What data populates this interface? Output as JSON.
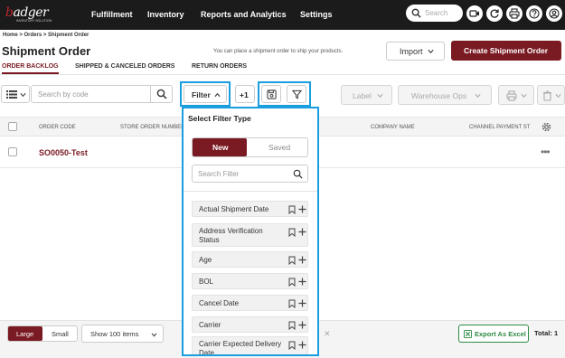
{
  "app": {
    "logo": "badger",
    "logo_sub": "INVENTORY SOLUTION"
  },
  "nav": {
    "items": [
      "Fulfillment",
      "Inventory",
      "Reports and Analytics",
      "Settings"
    ],
    "search_placeholder": "Search"
  },
  "header": {
    "breadcrumb": "Home  >  Orders  >  Shipment Order",
    "title": "Shipment Order",
    "hint": "You can place a shipment order to ship your products.",
    "import_label": "Import",
    "create_label": "Create Shipment Order"
  },
  "tabs": [
    "ORDER BACKLOG",
    "SHIPPED & CANCELED ORDERS",
    "RETURN ORDERS"
  ],
  "toolbar": {
    "code_search_placeholder": "Search by code",
    "filter_label": "Filter",
    "plus_one": "+1",
    "label_btn": "Label",
    "warehouse_ops_btn": "Warehouse Ops"
  },
  "table": {
    "columns": [
      "ORDER CODE",
      "STORE ORDER NUMBER",
      "COMPANY NAME",
      "CHANNEL PAYMENT ST"
    ],
    "rows": [
      {
        "order_code": "SO0050-Test"
      }
    ]
  },
  "filter_panel": {
    "title": "Select Filter Type",
    "tab_new": "New",
    "tab_saved": "Saved",
    "search_placeholder": "Search Filter",
    "items": [
      "Actual Shipment Date",
      "Address Verification Status",
      "Age",
      "BOL",
      "Cancel Date",
      "Carrier",
      "Carrier Expected Delivery Date"
    ]
  },
  "footer": {
    "size_large": "Large",
    "size_small": "Small",
    "show_label": "Show 100 items",
    "export_label": "Export As Excel",
    "total_label": "Total: 1"
  },
  "colors": {
    "brand": "#7a1a22",
    "highlight": "#1a9ee0",
    "export_green": "#2e8b45",
    "nav_bg": "#1b1b1b"
  }
}
